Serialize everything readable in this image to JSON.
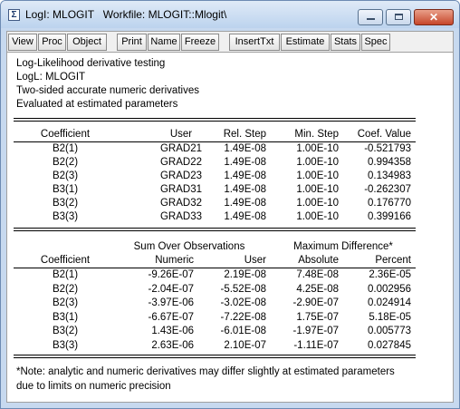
{
  "window": {
    "title": "LogI: MLOGIT   Workfile: MLOGIT::Mlogit\\",
    "icon_name": "eviews-window-icon"
  },
  "window_controls": {
    "minimize": "minimize-icon",
    "maximize": "maximize-icon",
    "close": "close-icon",
    "close_glyph": "✕"
  },
  "toolbar": {
    "buttons": [
      "View",
      "Proc",
      "Object",
      "Print",
      "Name",
      "Freeze",
      "InsertTxt",
      "Estimate",
      "Stats",
      "Spec"
    ]
  },
  "header": {
    "lines": [
      "Log-Likelihood derivative testing",
      "LogL: MLOGIT",
      "Two-sided accurate numeric derivatives",
      "Evaluated at estimated parameters"
    ]
  },
  "table1": {
    "columns": [
      "Coefficient",
      "User",
      "Rel. Step",
      "Min. Step",
      "Coef. Value"
    ],
    "rows": [
      [
        "B2(1)",
        "GRAD21",
        "1.49E-08",
        "1.00E-10",
        "-0.521793"
      ],
      [
        "B2(2)",
        "GRAD22",
        "1.49E-08",
        "1.00E-10",
        "0.994358"
      ],
      [
        "B2(3)",
        "GRAD23",
        "1.49E-08",
        "1.00E-10",
        "0.134983"
      ],
      [
        "B3(1)",
        "GRAD31",
        "1.49E-08",
        "1.00E-10",
        "-0.262307"
      ],
      [
        "B3(2)",
        "GRAD32",
        "1.49E-08",
        "1.00E-10",
        "0.176770"
      ],
      [
        "B3(3)",
        "GRAD33",
        "1.49E-08",
        "1.00E-10",
        "0.399166"
      ]
    ]
  },
  "table2": {
    "group_headers": [
      "Sum Over Observations",
      "Maximum Difference*"
    ],
    "columns": [
      "Coefficient",
      "Numeric",
      "User",
      "Absolute",
      "Percent"
    ],
    "rows": [
      [
        "B2(1)",
        "-9.26E-07",
        "2.19E-08",
        "7.48E-08",
        "2.36E-05"
      ],
      [
        "B2(2)",
        "-2.04E-07",
        "-5.52E-08",
        "4.25E-08",
        "0.002956"
      ],
      [
        "B2(3)",
        "-3.97E-06",
        "-3.02E-08",
        "-2.90E-07",
        "0.024914"
      ],
      [
        "B3(1)",
        "-6.67E-07",
        "-7.22E-08",
        "1.75E-07",
        "5.18E-05"
      ],
      [
        "B3(2)",
        "1.43E-06",
        "-6.01E-08",
        "-1.97E-07",
        "0.005773"
      ],
      [
        "B3(3)",
        "2.63E-06",
        "2.10E-07",
        "-1.11E-07",
        "0.027845"
      ]
    ]
  },
  "note": "*Note: analytic and numeric derivatives may differ slightly at estimated parameters due to limits on numeric precision"
}
